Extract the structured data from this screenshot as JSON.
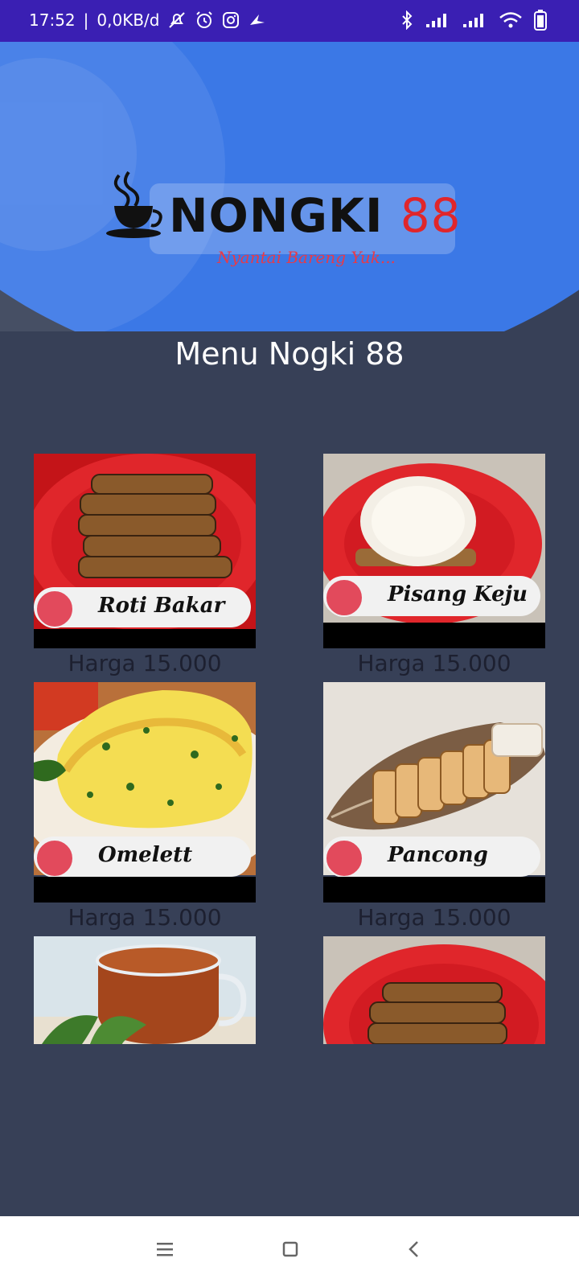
{
  "status_bar": {
    "time": "17:52",
    "separator": "|",
    "data_rate": "0,0KB/d",
    "left_icons": [
      "mute-icon",
      "alarm-icon",
      "instagram-icon",
      "app-icon"
    ],
    "right_icons": [
      "bluetooth-icon",
      "signal-icon",
      "signal-icon",
      "wifi-icon",
      "battery-icon"
    ]
  },
  "header": {
    "logo_word": "NONGKI",
    "logo_number": "88",
    "tagline": "Nyantai Bareng Yuk..."
  },
  "page_title": "Menu Nogki 88",
  "menu": [
    {
      "name": "Roti Bakar",
      "price": "Harga 15.000",
      "image": "grilled-bread-on-red-plate"
    },
    {
      "name": "Pisang Keju",
      "price": "Harga 15.000",
      "image": "banana-with-cheese-on-red-plate"
    },
    {
      "name": "Omelett",
      "price": "Harga 15.000",
      "image": "omelette"
    },
    {
      "name": "Pancong",
      "price": "Harga 15.000",
      "image": "pancong-on-leaf-plate"
    },
    {
      "name": "",
      "price": "",
      "image": "tea-cup"
    },
    {
      "name": "",
      "price": "",
      "image": "grilled-bread-on-red-plate"
    }
  ],
  "colors": {
    "status_bar": "#3a1fb3",
    "header_blue": "#3b78e6",
    "background": "#374057",
    "plate_red": "#e0262b",
    "accent_dot": "#e24a5c"
  },
  "nav": [
    "menu-icon",
    "home-icon",
    "back-icon"
  ]
}
